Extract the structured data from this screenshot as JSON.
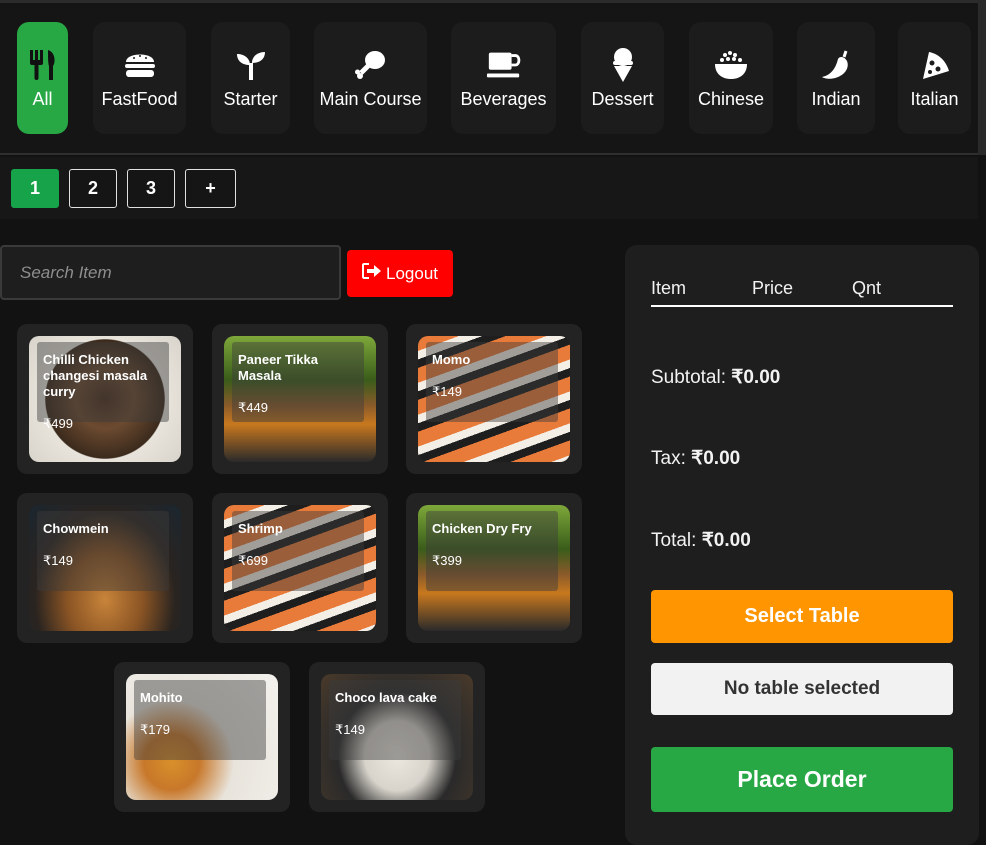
{
  "categories": [
    {
      "label": "All",
      "icon": "utensils-icon",
      "active": true
    },
    {
      "label": "FastFood",
      "icon": "burger-icon"
    },
    {
      "label": "Starter",
      "icon": "seedling-icon"
    },
    {
      "label": "Main Course",
      "icon": "drumstick-icon"
    },
    {
      "label": "Beverages",
      "icon": "mug-icon"
    },
    {
      "label": "Dessert",
      "icon": "ice-cream-icon"
    },
    {
      "label": "Chinese",
      "icon": "bowl-rice-icon"
    },
    {
      "label": "Indian",
      "icon": "pepper-icon"
    },
    {
      "label": "Italian",
      "icon": "pizza-icon"
    }
  ],
  "pages": [
    "1",
    "2",
    "3",
    "+"
  ],
  "search": {
    "placeholder": "Search Item"
  },
  "logout_label": "Logout",
  "menu_items": [
    {
      "name": "Chilli Chicken changesi masala curry",
      "price": "₹499",
      "image": "plated-food"
    },
    {
      "name": "Paneer Tikka Masala",
      "price": "₹449",
      "image": "grill"
    },
    {
      "name": "Momo",
      "price": "₹149",
      "image": "sushi"
    },
    {
      "name": "Chowmein",
      "price": "₹149",
      "image": "noodles"
    },
    {
      "name": "Shrimp",
      "price": "₹699",
      "image": "sushi"
    },
    {
      "name": "Chicken Dry Fry",
      "price": "₹399",
      "image": "grill"
    },
    {
      "name": "Mohito",
      "price": "₹179",
      "image": "drinks"
    },
    {
      "name": "Choco lava cake",
      "price": "₹149",
      "image": "rice-bowl"
    }
  ],
  "order": {
    "columns": [
      "Item",
      "Price",
      "Qnt"
    ],
    "subtotal_label": "Subtotal:",
    "subtotal": "₹0.00",
    "tax_label": "Tax:",
    "tax": "₹0.00",
    "total_label": "Total:",
    "total": "₹0.00",
    "select_table": "Select Table",
    "table_status": "No table selected",
    "place_order": "Place Order"
  },
  "colors": {
    "accent_green": "#28a745",
    "logout_red": "#ff0000",
    "select_table_orange": "#ff9500",
    "background": "#121212"
  }
}
